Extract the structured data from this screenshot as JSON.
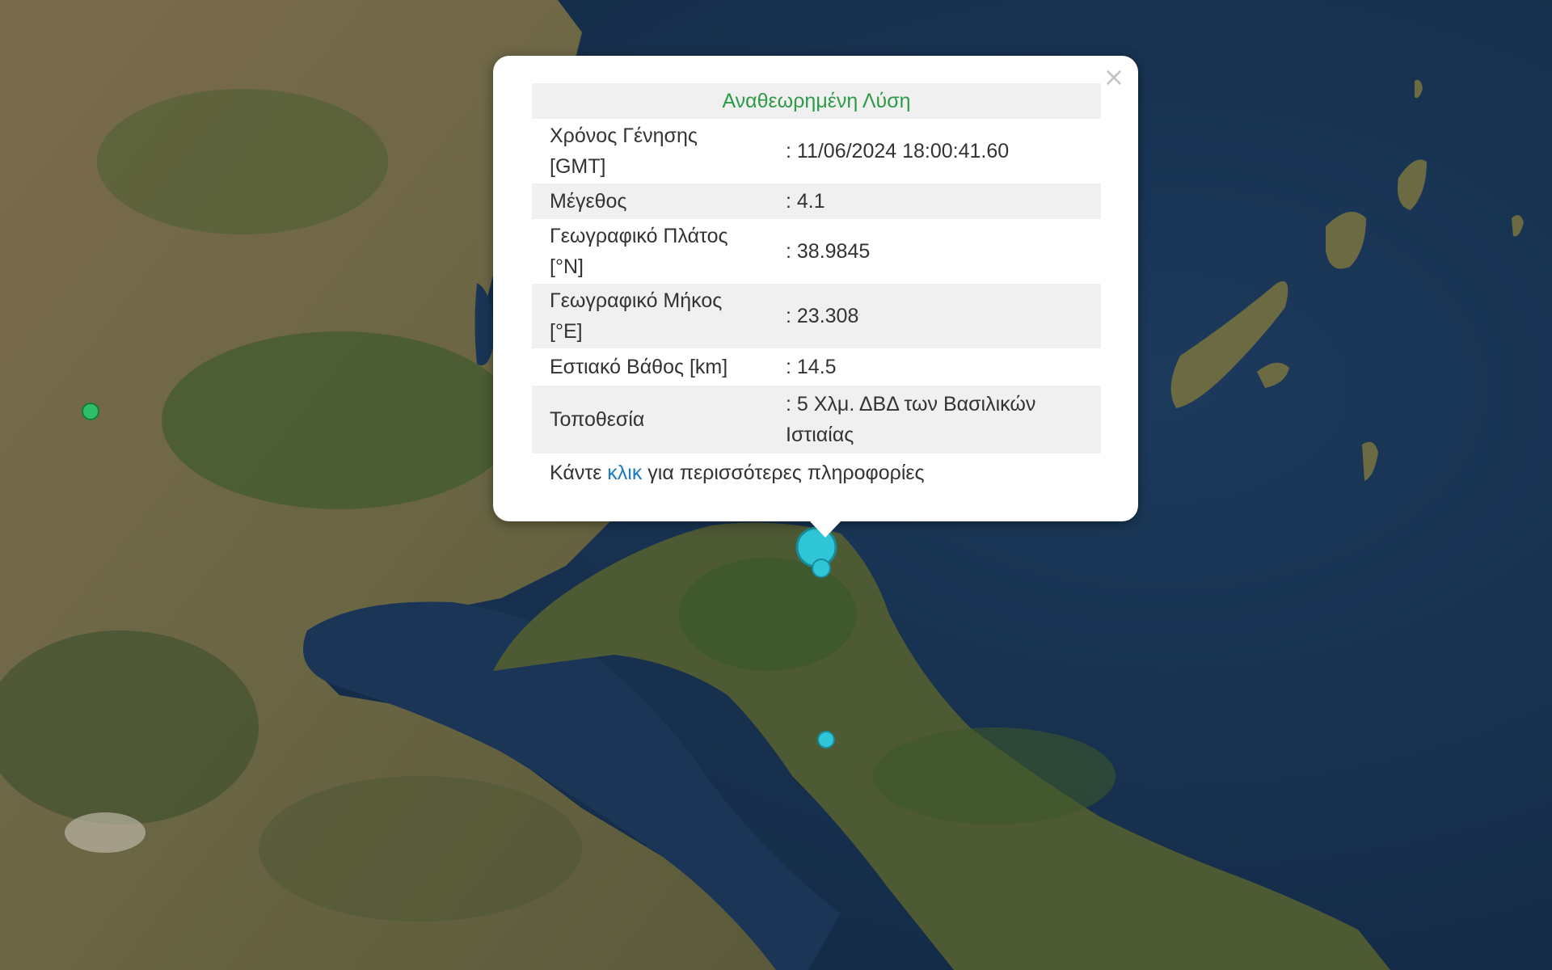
{
  "popup": {
    "close_symbol": "×",
    "header": "Αναθεωρημένη Λύση",
    "rows": [
      {
        "label": "Χρόνος Γένησης [GMT]",
        "value": ": 11/06/2024 18:00:41.60"
      },
      {
        "label": "Μέγεθος",
        "value": ": 4.1"
      },
      {
        "label": "Γεωγραφικό Πλάτος [°N]",
        "value": ": 38.9845"
      },
      {
        "label": "Γεωγραφικό Μήκος [°E]",
        "value": ": 23.308"
      },
      {
        "label": "Εστιακό Βάθος [km]",
        "value": ": 14.5"
      },
      {
        "label": "Τοποθεσία",
        "value": ": 5 Χλμ. ΔΒΔ των Βασιλικών Ιστιαίας"
      }
    ],
    "footer": {
      "before": "Κάντε ",
      "link": "κλικ",
      "after": " για περισσότερες πληροφορίες"
    }
  },
  "colors": {
    "sea": "#17314f",
    "land_brown": "#7a6a4a",
    "land_green": "#3f5a2c",
    "marker_cyan": "#2fc6d8",
    "marker_green": "#2fbf6a",
    "header_green": "#2e9a46",
    "link_blue": "#1a7ac2"
  },
  "map": {
    "basemap": "satellite",
    "markers": [
      {
        "type": "earthquake-epicenter",
        "color": "cyan"
      },
      {
        "type": "earthquake-event",
        "color": "cyan"
      },
      {
        "type": "earthquake-event",
        "color": "cyan"
      },
      {
        "type": "earthquake-event",
        "color": "green"
      }
    ]
  }
}
